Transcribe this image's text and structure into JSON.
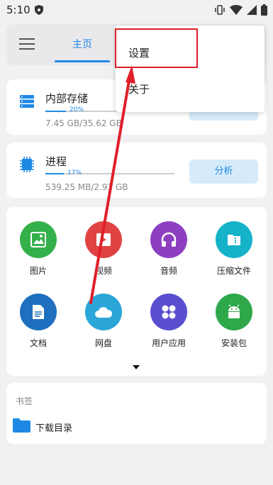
{
  "status_bar": {
    "time": "5:10"
  },
  "tabs": {
    "home": "主页"
  },
  "storage": {
    "title": "内部存储",
    "percent": "20%",
    "progress": 0.2,
    "size": "7.45 GB/35.62 GB"
  },
  "process": {
    "title": "进程",
    "percent": "17%",
    "progress": 0.17,
    "size": "539.25 MB/2.93 GB",
    "analyze_label": "分析"
  },
  "categories": [
    {
      "label": "图片",
      "color": "#34b04a",
      "icon": "image-icon"
    },
    {
      "label": "视频",
      "color": "#e04343",
      "icon": "video-icon"
    },
    {
      "label": "音频",
      "color": "#8e3fc1",
      "icon": "headphones-icon"
    },
    {
      "label": "压缩文件",
      "color": "#14b3c9",
      "icon": "archive-icon"
    },
    {
      "label": "文档",
      "color": "#1f6fbf",
      "icon": "document-icon"
    },
    {
      "label": "网盘",
      "color": "#2aa6d8",
      "icon": "cloud-icon"
    },
    {
      "label": "用户应用",
      "color": "#5a4fcf",
      "icon": "apps-icon"
    },
    {
      "label": "安装包",
      "color": "#2ea84a",
      "icon": "android-icon"
    }
  ],
  "bookmarks": {
    "header": "书签",
    "items": [
      {
        "label": "下载目录",
        "icon": "folder-icon"
      }
    ]
  },
  "overflow_menu": {
    "items": [
      "设置",
      "关于"
    ]
  },
  "accent": "#1e88e5",
  "annotation_color": "#e0202a"
}
